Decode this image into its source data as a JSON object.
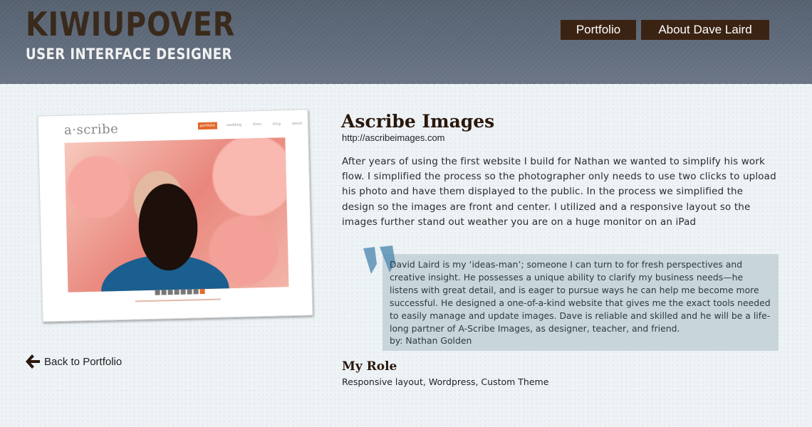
{
  "header": {
    "logo": "KIWIUPOVER",
    "tagline": "USER INTERFACE DESIGNER",
    "nav": [
      {
        "label": "Portfolio"
      },
      {
        "label": "About Dave Laird"
      }
    ],
    "colors": {
      "nav_bg": "#3b2313",
      "logo": "#3a2a1c",
      "header_bg": "#5f6b7b"
    }
  },
  "project": {
    "screenshot": {
      "logo": "a·scribe",
      "nav": [
        "portfolio",
        "wedding",
        "films",
        "blog",
        "about"
      ]
    },
    "back_link": {
      "label": "Back to Portfolio",
      "icon": "arrow-left-icon"
    },
    "title": "Ascribe Images",
    "url": "http://ascribeimages.com",
    "description": "After years of using the first website I build for Nathan we wanted to simplify his work flow. I simplified the process so the photographer only needs to use two clicks to upload his photo and have them displayed to the public. In the process we simplified the design so the images are front and center. I utilized and a responsive layout so the images further stand out weather you are on a huge monitor on an iPad",
    "testimonial": {
      "text": "David Laird is my ‘ideas-man’; someone I can turn to for fresh perspectives and creative insight. He possesses a unique ability to clarify my business needs—he listens with great detail, and is eager to pursue ways he can help me become more successful. He designed a one-of-a-kind website that gives me the exact tools needed to easily manage and update images. Dave is reliable and skilled and he will be a life-long partner of A-Scribe Images, as designer, teacher, and friend.",
      "author": "by: Nathan Golden",
      "icon": "quote-icon",
      "colors": {
        "box_bg": "#c8d6db",
        "quote_mark": "#5b8fb5"
      }
    },
    "role": {
      "title": "My Role",
      "text": "Responsive layout, Wordpress, Custom Theme"
    }
  }
}
